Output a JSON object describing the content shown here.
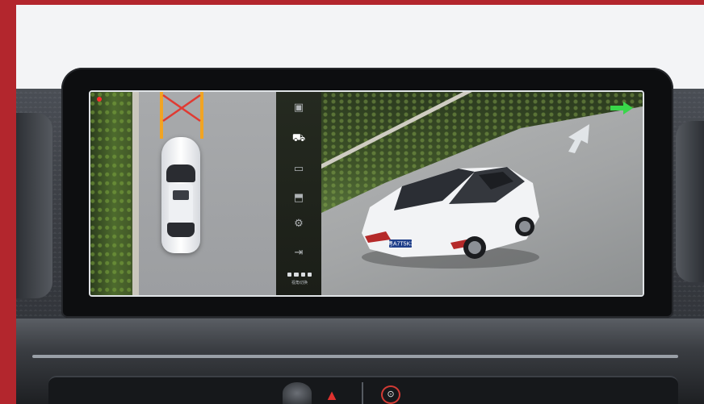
{
  "colors": {
    "brand_frame": "#b3262d",
    "guide_line": "#f1a423",
    "guide_cross": "#e03a32",
    "green_indicator": "#39d64a",
    "hazard": "#e0322f",
    "recording_dot": "#ff2d2d"
  },
  "screen": {
    "top_view": {
      "recording_indicator": "recording-dot",
      "parking_guide": "orange-guide-lines-with-red-x"
    },
    "menu": {
      "items": [
        {
          "icon": "car-front-view-icon"
        },
        {
          "icon": "car-3d-view-icon",
          "active": true
        },
        {
          "icon": "car-side-view-icon"
        },
        {
          "icon": "car-rear-view-icon"
        },
        {
          "icon": "settings-icon"
        },
        {
          "icon": "exit-icon"
        }
      ],
      "view_selector_label": "视角切换"
    },
    "view3d": {
      "license_plate": "粤A7T5K3",
      "direction_arrow": "white-up-arrow",
      "indicator": "green-right-arrow"
    }
  },
  "console": {
    "hazard_icon": "hazard-icon",
    "control_icon": "car-lock-icon"
  }
}
